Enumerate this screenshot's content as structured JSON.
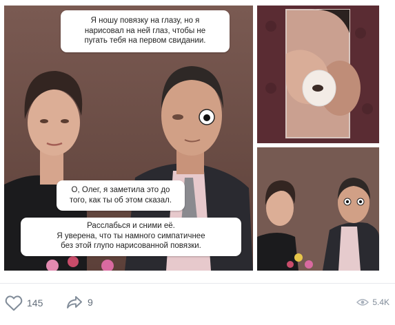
{
  "post": {
    "bubbles": {
      "top": "Я ношу повязку на глазу, но я\nнарисовал на ней глаз, чтобы не\nпугать тебя на первом свидании.",
      "middle": "О, Олег, я заметила это до\nтого, как ты об этом сказал.",
      "bottom": "Расслабься и сними её.\nЯ уверена, что ты намного симпатичнее\nбез этой глупо нарисованной повязки."
    },
    "images": [
      {
        "icon": "couple-portrait-main"
      },
      {
        "icon": "hand-removing-eyepatch"
      },
      {
        "icon": "couple-portrait-small"
      }
    ]
  },
  "footer": {
    "likes": "145",
    "shares": "9",
    "views": "5.4K"
  },
  "colors": {
    "background": "#ffffff",
    "icon": "#818c99",
    "divider": "#e7e8ec"
  }
}
